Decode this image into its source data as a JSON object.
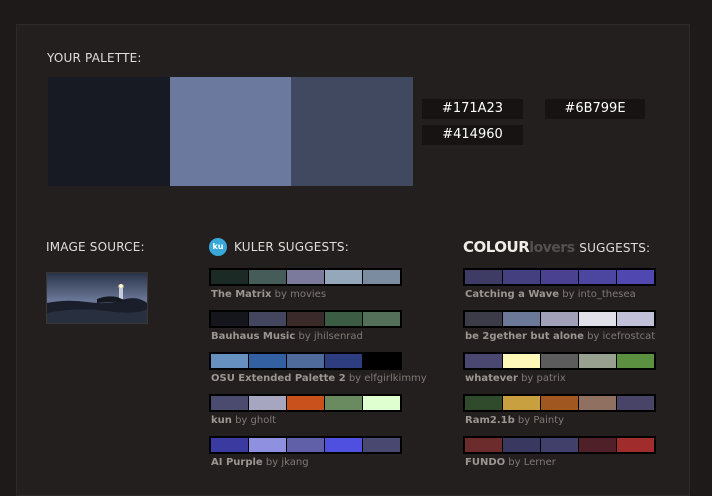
{
  "your_palette": {
    "label": "YOUR PALETTE:",
    "colors": [
      "#171A23",
      "#6B799E",
      "#414960"
    ]
  },
  "image_source": {
    "label": "IMAGE SOURCE:"
  },
  "kuler": {
    "icon_text": "ku",
    "heading": "KULER SUGGESTS:",
    "palettes": [
      {
        "name": "The Matrix",
        "by": "by",
        "author": "movies",
        "colors": [
          "#1b2a25",
          "#465c58",
          "#7c7a9c",
          "#95a7ba",
          "#7b8ba0"
        ]
      },
      {
        "name": "Bauhaus Music",
        "by": "by",
        "author": "jhilsenrad",
        "colors": [
          "#14161b",
          "#444660",
          "#3a2a2a",
          "#3c5c43",
          "#55705a"
        ]
      },
      {
        "name": "OSU Extended Palette 2",
        "by": "by",
        "author": "elfgirlkimmy",
        "colors": [
          "#6690c0",
          "#3260a0",
          "#4e6b9c",
          "#2e3c80",
          "#000000"
        ]
      },
      {
        "name": "kun",
        "by": "by",
        "author": "gholt",
        "colors": [
          "#4b4a6f",
          "#a6a6c0",
          "#c8511c",
          "#6a8a60",
          "#dfffd0"
        ]
      },
      {
        "name": "AI Purple",
        "by": "by",
        "author": "jkang",
        "colors": [
          "#3a3aa0",
          "#9090e0",
          "#6060a8",
          "#5050e0",
          "#484870"
        ]
      }
    ]
  },
  "colourlovers": {
    "logo_bold": "COLOUR",
    "logo_light": "lovers",
    "heading": "SUGGESTS:",
    "palettes": [
      {
        "name": "Catching a Wave",
        "by": "by",
        "author": "into_thesea",
        "colors": [
          "#3e3c64",
          "#444080",
          "#4a4290",
          "#4c46a0",
          "#5048b0"
        ]
      },
      {
        "name": "be 2gether but alone",
        "by": "by",
        "author": "icefrostcat",
        "colors": [
          "#3c3c48",
          "#6b7898",
          "#a0a0b8",
          "#e0e0e8",
          "#c0c0d8"
        ]
      },
      {
        "name": "whatever",
        "by": "by",
        "author": "patrix",
        "colors": [
          "#4a4870",
          "#fff8b8",
          "#5c5c5c",
          "#98a090",
          "#5a9040"
        ]
      },
      {
        "name": "Ram2.1b",
        "by": "by",
        "author": "Painty",
        "colors": [
          "#304a2c",
          "#c8a040",
          "#a05820",
          "#907060",
          "#484468"
        ]
      },
      {
        "name": "FUNDO",
        "by": "by",
        "author": "Lerner",
        "colors": [
          "#6c2c2c",
          "#383860",
          "#40406a",
          "#502028",
          "#a02c2c"
        ]
      }
    ]
  }
}
